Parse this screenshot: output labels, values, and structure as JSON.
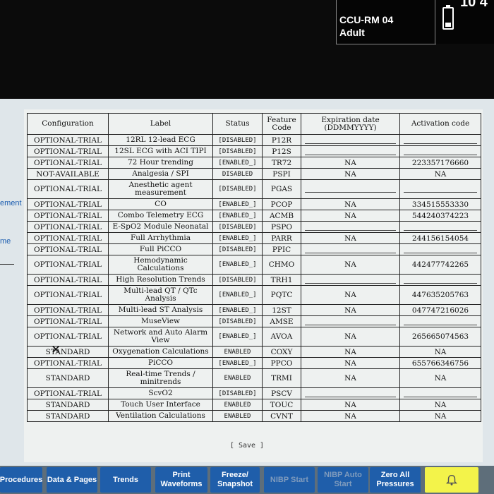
{
  "header": {
    "bed_label": "CCU-RM 04",
    "patient_category": "Adult",
    "clock_fragment": "10 4"
  },
  "left_menu": {
    "item_a": "ement",
    "item_b": "me"
  },
  "table": {
    "headers": [
      "Configuration",
      "Label",
      "Status",
      "Feature Code",
      "Expiration date (DDMMYYYY)",
      "Activation code"
    ],
    "rows": [
      {
        "config": "OPTIONAL-TRIAL",
        "label": "12RL 12-lead ECG",
        "status": "[DISABLED]",
        "code": "P12R",
        "expiration": "",
        "activation": ""
      },
      {
        "config": "OPTIONAL-TRIAL",
        "label": "12SL ECG with ACI TIPI",
        "status": "[DISABLED]",
        "code": "P12S",
        "expiration": "",
        "activation": ""
      },
      {
        "config": "OPTIONAL-TRIAL",
        "label": "72 Hour trending",
        "status": "[ENABLED_]",
        "code": "TR72",
        "expiration": "NA",
        "activation": "223357176660"
      },
      {
        "config": "NOT-AVAILABLE",
        "label": "Analgesia / SPI",
        "status": "DISABLED",
        "code": "PSPI",
        "expiration": "NA",
        "activation": "NA"
      },
      {
        "config": "OPTIONAL-TRIAL",
        "label": "Anesthetic agent measurement",
        "status": "[DISABLED]",
        "code": "PGAS",
        "expiration": "",
        "activation": ""
      },
      {
        "config": "OPTIONAL-TRIAL",
        "label": "CO",
        "status": "[ENABLED_]",
        "code": "PCOP",
        "expiration": "NA",
        "activation": "334515553330"
      },
      {
        "config": "OPTIONAL-TRIAL",
        "label": "Combo Telemetry ECG",
        "status": "[ENABLED_]",
        "code": "ACMB",
        "expiration": "NA",
        "activation": "544240374223"
      },
      {
        "config": "OPTIONAL-TRIAL",
        "label": "E-SpO2 Module Neonatal",
        "status": "[DISABLED]",
        "code": "PSPO",
        "expiration": "",
        "activation": ""
      },
      {
        "config": "OPTIONAL-TRIAL",
        "label": "Full Arrhythmia",
        "status": "[ENABLED_]",
        "code": "PARR",
        "expiration": "NA",
        "activation": "244156154054"
      },
      {
        "config": "OPTIONAL-TRIAL",
        "label": "Full PiCCO",
        "status": "[DISABLED]",
        "code": "PPIC",
        "expiration": "",
        "activation": ""
      },
      {
        "config": "OPTIONAL-TRIAL",
        "label": "Hemodynamic Calculations",
        "status": "[ENABLED_]",
        "code": "CHMO",
        "expiration": "NA",
        "activation": "442477742265"
      },
      {
        "config": "OPTIONAL-TRIAL",
        "label": "High Resolution Trends",
        "status": "[DISABLED]",
        "code": "TRH1",
        "expiration": "",
        "activation": ""
      },
      {
        "config": "OPTIONAL-TRIAL",
        "label": "Multi-lead QT / QTc Analysis",
        "status": "[ENABLED_]",
        "code": "PQTC",
        "expiration": "NA",
        "activation": "447635205763"
      },
      {
        "config": "OPTIONAL-TRIAL",
        "label": "Multi-lead ST Analysis",
        "status": "[ENABLED_]",
        "code": "12ST",
        "expiration": "NA",
        "activation": "047747216026"
      },
      {
        "config": "OPTIONAL-TRIAL",
        "label": "MuseView",
        "status": "[DISABLED]",
        "code": "AMSE",
        "expiration": "",
        "activation": ""
      },
      {
        "config": "OPTIONAL-TRIAL",
        "label": "Network and Auto Alarm View",
        "status": "[ENABLED_]",
        "code": "AVOA",
        "expiration": "NA",
        "activation": "265665074563"
      },
      {
        "config": "STANDARD",
        "label": "Oxygenation Calculations",
        "status": "ENABLED",
        "code": "COXY",
        "expiration": "NA",
        "activation": "NA"
      },
      {
        "config": "OPTIONAL-TRIAL",
        "label": "PiCCO",
        "status": "[ENABLED_]",
        "code": "PPCO",
        "expiration": "NA",
        "activation": "655766346756"
      },
      {
        "config": "STANDARD",
        "label": "Real-time Trends / minitrends",
        "status": "ENABLED",
        "code": "TRMI",
        "expiration": "NA",
        "activation": "NA"
      },
      {
        "config": "OPTIONAL-TRIAL",
        "label": "ScvO2",
        "status": "[DISABLED]",
        "code": "PSCV",
        "expiration": "",
        "activation": ""
      },
      {
        "config": "STANDARD",
        "label": "Touch User Interface",
        "status": "ENABLED",
        "code": "TOUC",
        "expiration": "NA",
        "activation": "NA"
      },
      {
        "config": "STANDARD",
        "label": "Ventilation Calculations",
        "status": "ENABLED",
        "code": "CVNT",
        "expiration": "NA",
        "activation": "NA"
      }
    ]
  },
  "save_button": "[ Save ]",
  "bottom_buttons": {
    "procedures": "Procedures",
    "data_pages": "Data & Pages",
    "trends": "Trends",
    "print_waveforms": "Print Waveforms",
    "freeze_snapshot": "Freeze/ Snapshot",
    "nibp_start": "NIBP Start",
    "nibp_auto_start": "NIBP Auto Start",
    "zero_all": "Zero All Pressures"
  },
  "colors": {
    "button_blue": "#1f5eaa",
    "alarm_yellow": "#f3f34a",
    "screen_bg": "#dfe6ea"
  }
}
